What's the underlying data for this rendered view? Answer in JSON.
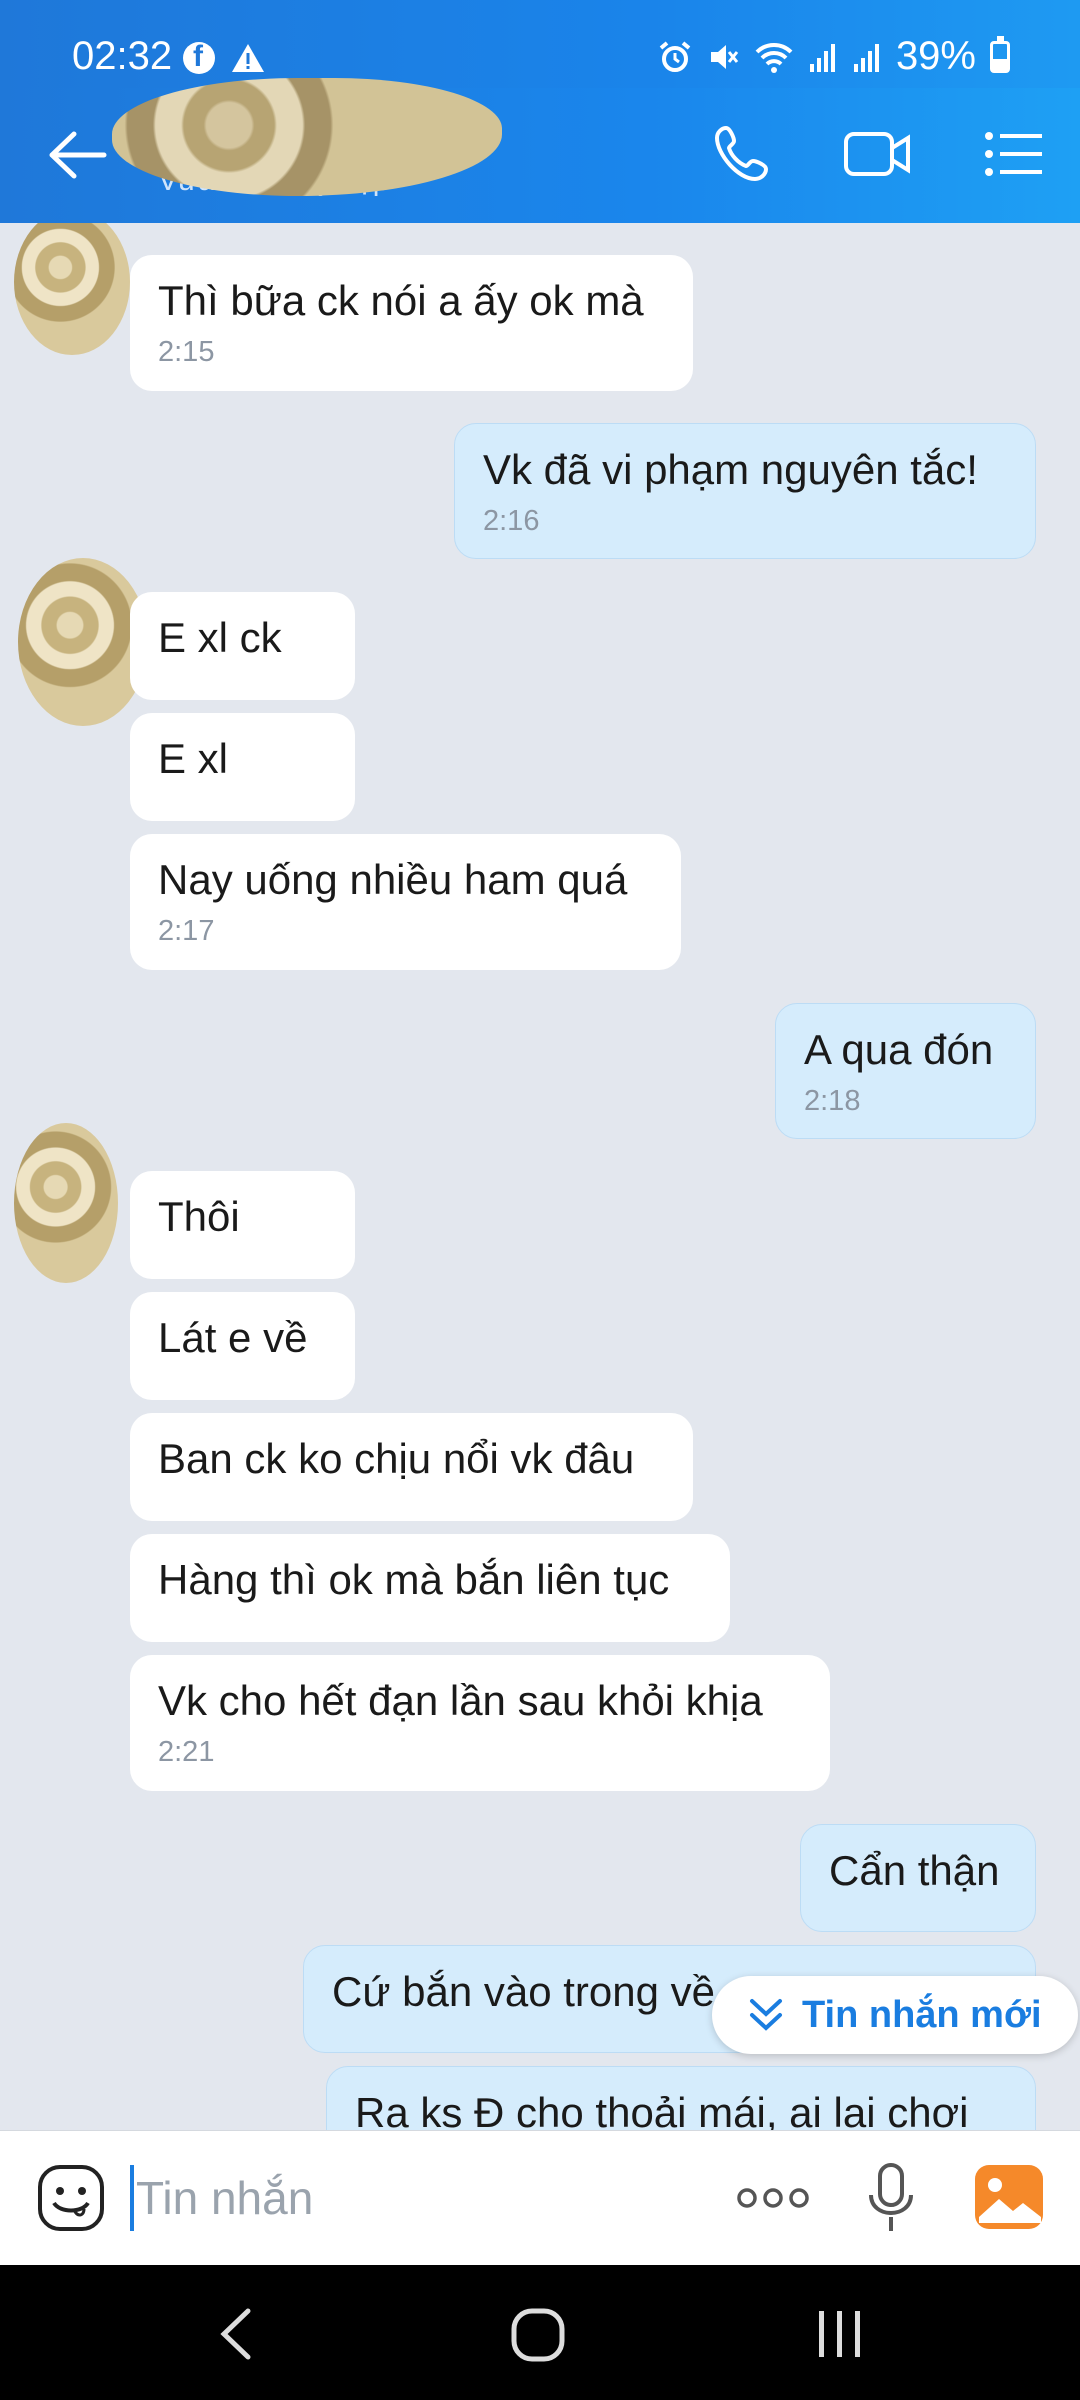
{
  "status_bar": {
    "time": "02:32",
    "battery": "39%"
  },
  "header": {
    "status": "Vừa mới truy cập"
  },
  "messages": [
    {
      "text": "Thì bữa ck nói a ấy ok mà",
      "time": "2:15"
    },
    {
      "text": "Vk đã vi phạm nguyên tắc!",
      "time": "2:16"
    },
    {
      "text": "E xl ck"
    },
    {
      "text": "E xl"
    },
    {
      "text": "Nay uống nhiều ham quá",
      "time": "2:17"
    },
    {
      "text": "A qua đón",
      "time": "2:18"
    },
    {
      "text": "Thôi"
    },
    {
      "text": "Lát e về"
    },
    {
      "text": "Ban ck ko chịu nổi vk đâu"
    },
    {
      "text": "Hàng thì ok mà bắn liên tục"
    },
    {
      "text": "Vk cho hết đạn lần sau khỏi khịa",
      "time": "2:21"
    },
    {
      "text": "Cẩn thận"
    },
    {
      "text": "Cứ bắn vào trong về"
    },
    {
      "text": "Ra ks Đ cho thoải mái, ai lại chơi"
    }
  ],
  "new_messages_label": "Tin nhắn mới",
  "input": {
    "placeholder": "Tin nhắn"
  },
  "colors": {
    "header_blue": "#1a84ea",
    "outgoing_bubble": "#d5ecfc",
    "incoming_bubble": "#ffffff",
    "chat_bg": "#e3e7ee"
  },
  "icons": [
    "back-arrow-icon",
    "phone-icon",
    "video-call-icon",
    "menu-icon",
    "emoji-icon",
    "more-icon",
    "microphone-icon",
    "image-icon"
  ]
}
